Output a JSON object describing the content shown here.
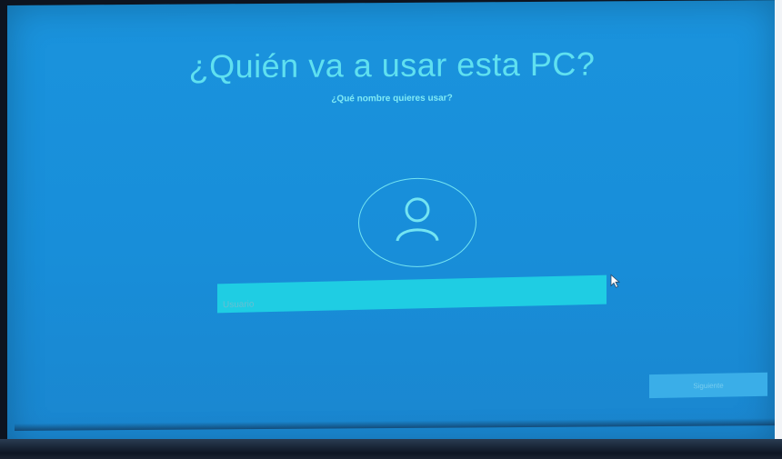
{
  "setup": {
    "title": "¿Quién va a usar esta PC?",
    "subtitle": "¿Qué nombre quieres usar?",
    "name_input": {
      "placeholder": "Usuario",
      "value": ""
    },
    "next_button_label": "Siguiente"
  },
  "icons": {
    "avatar": "user-icon",
    "cursor": "mouse-pointer-icon"
  },
  "colors": {
    "background": "#188ed9",
    "accent_text": "#5fe0f0",
    "input_fill": "#1fcde3",
    "button_fill": "#3aaee8"
  }
}
